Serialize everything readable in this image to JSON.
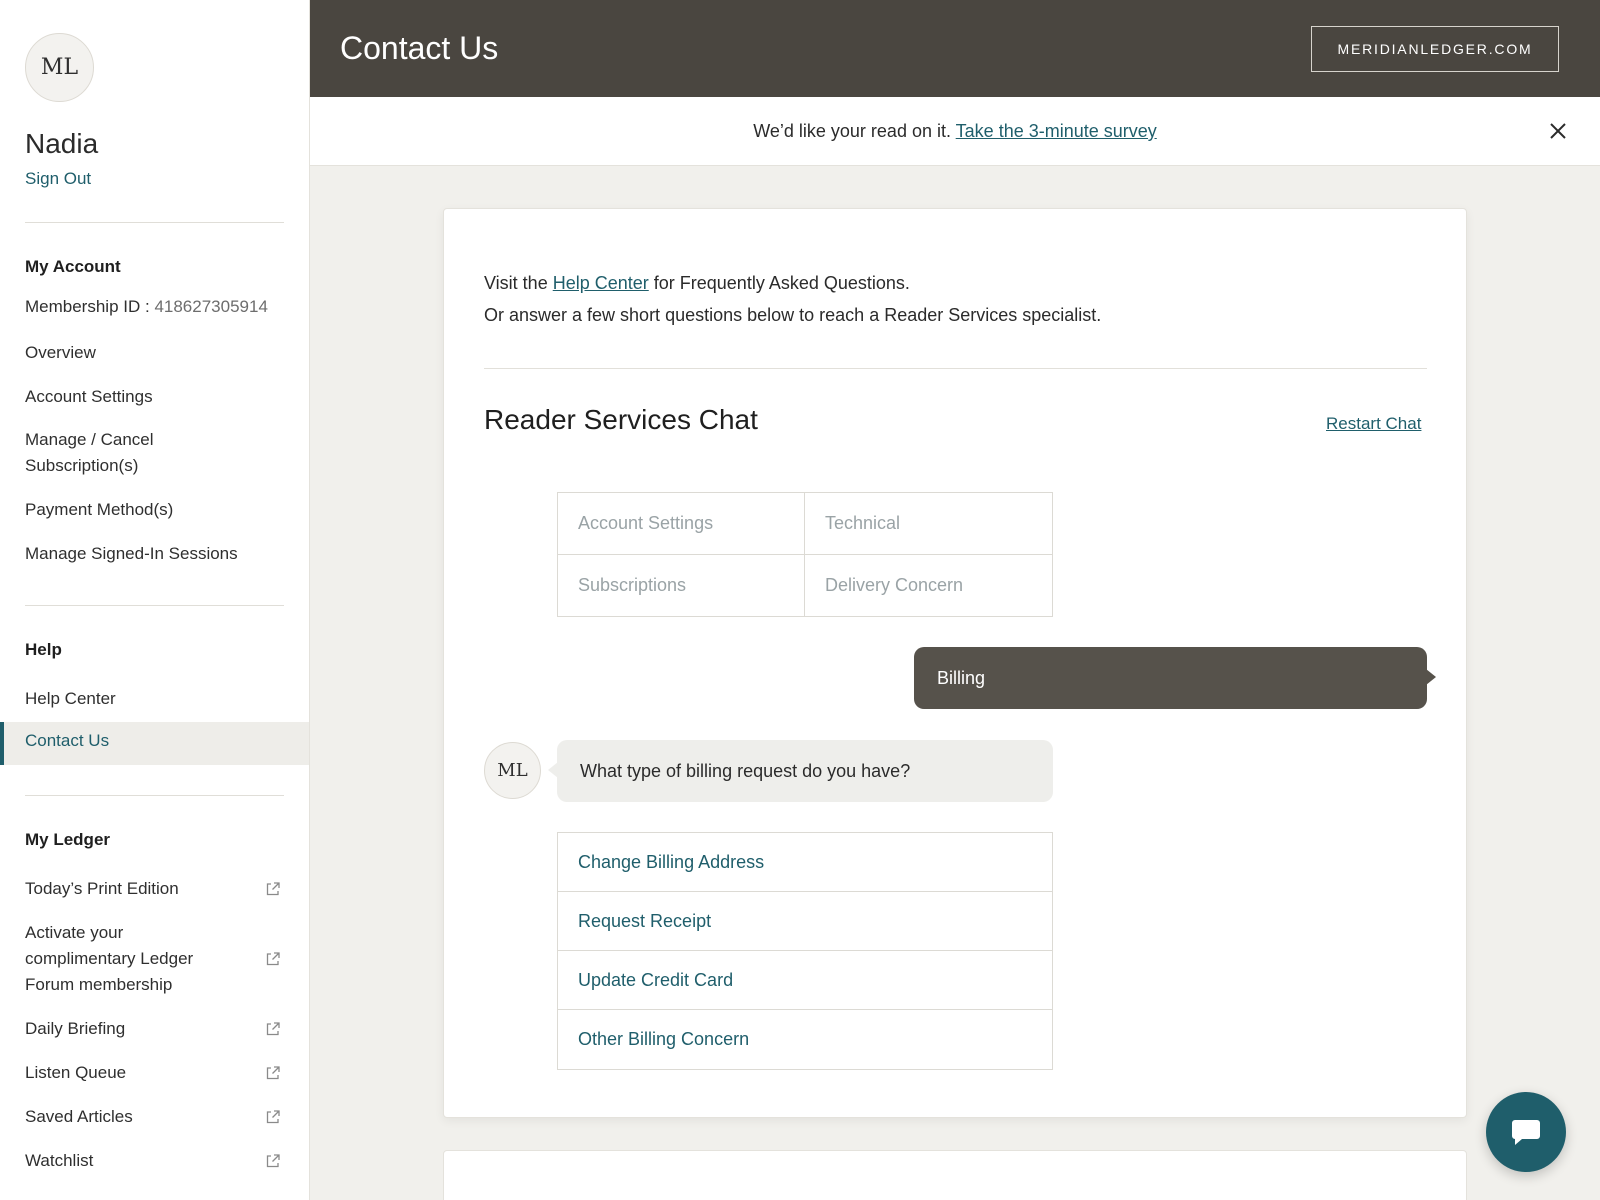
{
  "sidebar": {
    "avatar_initials": "ML",
    "user_name": "Nadia",
    "sign_out": "Sign Out",
    "my_account": {
      "title": "My Account",
      "membership_label": "Membership ID : ",
      "membership_id": "418627305914",
      "items": [
        "Overview",
        "Account Settings",
        "Manage / Cancel Subscription(s)",
        "Payment Method(s)",
        "Manage Signed-In Sessions"
      ]
    },
    "help": {
      "title": "Help",
      "items": [
        "Help Center",
        "Contact Us"
      ],
      "active": "Contact Us"
    },
    "my_ledger": {
      "title": "My Ledger",
      "items": [
        "Today’s Print Edition",
        "Activate your complimentary Ledger Forum membership",
        "Daily Briefing",
        "Listen Queue",
        "Saved Articles",
        "Watchlist"
      ]
    }
  },
  "header": {
    "title": "Contact Us",
    "site_button": "MERIDIANLEDGER.COM"
  },
  "survey": {
    "text": "We’d like your read on it. ",
    "link": "Take the 3-minute survey"
  },
  "main": {
    "intro_line1_prefix": "Visit the ",
    "intro_link": "Help Center",
    "intro_line1_suffix": " for Frequently Asked Questions.",
    "intro_line2": "Or answer a few short questions below to reach a Reader Services specialist.",
    "chat_title": "Reader Services Chat",
    "restart": "Restart Chat",
    "topics": [
      "Account Settings",
      "Technical",
      "Subscriptions",
      "Delivery Concern"
    ],
    "user_message": "Billing",
    "bot_initials": "ML",
    "bot_message": "What type of billing request do you have?",
    "options": [
      "Change Billing Address",
      "Request Receipt",
      "Update Credit Card",
      "Other Billing Concern"
    ]
  },
  "colors": {
    "accent": "#1f5e6b",
    "header_bg": "#4a4640",
    "page_bg": "#f1f0ec"
  }
}
